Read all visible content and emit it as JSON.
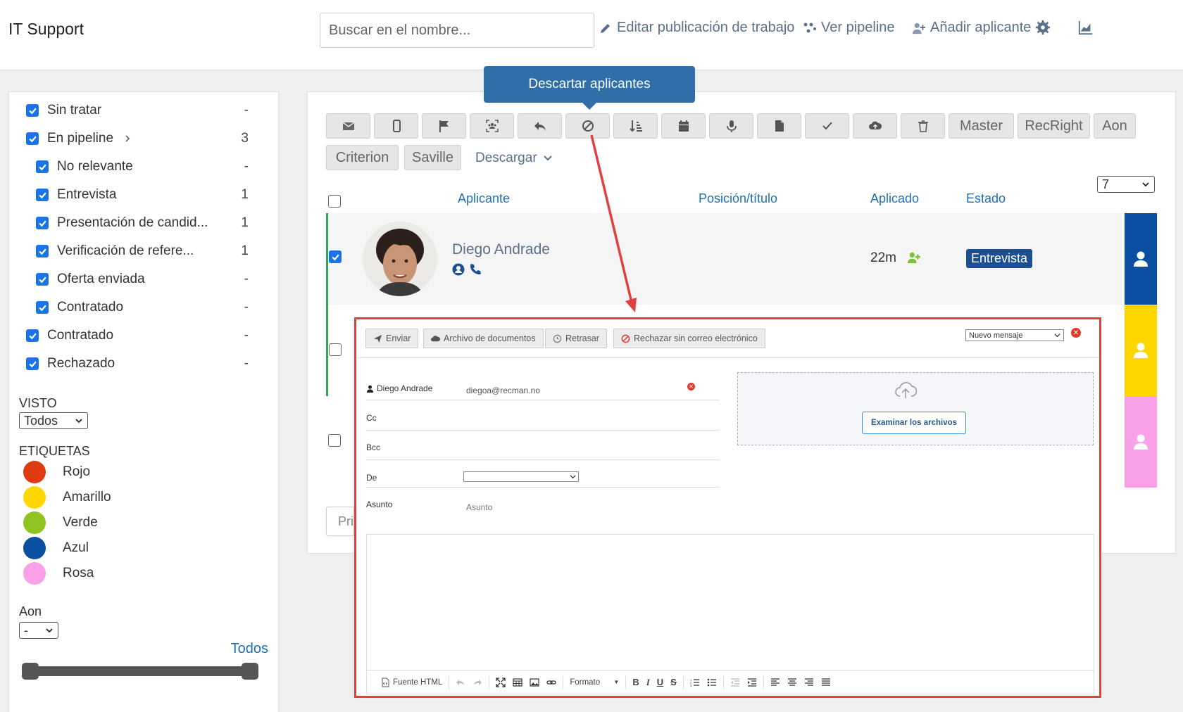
{
  "header": {
    "title": "IT Support",
    "search_placeholder": "Buscar en el nombre...",
    "edit_job": "Editar publicación de trabajo",
    "pipeline": "Ver pipeline",
    "add_applicant": "Añadir aplicante"
  },
  "filters": {
    "items": [
      {
        "label": "Sin tratar",
        "count": "-"
      },
      {
        "label": "En pipeline",
        "count": "3"
      },
      {
        "label": "No relevante",
        "count": "-"
      },
      {
        "label": "Entrevista",
        "count": "1"
      },
      {
        "label": "Presentación de candid...",
        "count": "1"
      },
      {
        "label": "Verificación de refere...",
        "count": "1"
      },
      {
        "label": "Oferta enviada",
        "count": "-"
      },
      {
        "label": "Contratado",
        "count": "-"
      },
      {
        "label": "Contratado",
        "count": "-"
      },
      {
        "label": "Rechazado",
        "count": "-"
      }
    ],
    "seen_label": "VISTO",
    "seen_value": "Todos",
    "tags_label": "ETIQUETAS",
    "tags": [
      {
        "label": "Rojo",
        "color": "#e03a12"
      },
      {
        "label": "Amarillo",
        "color": "#ffd600"
      },
      {
        "label": "Verde",
        "color": "#8fc31f"
      },
      {
        "label": "Azul",
        "color": "#0b4fa3"
      },
      {
        "label": "Rosa",
        "color": "#f9a0e8"
      }
    ],
    "aon_label": "Aon",
    "aon_value": "-",
    "all_link": "Todos"
  },
  "toolbar": {
    "master": "Master",
    "recright": "RecRight",
    "aon": "Aon",
    "criterion": "Criterion",
    "saville": "Saville",
    "download": "Descargar",
    "tooltip": "Descartar aplicantes"
  },
  "table": {
    "col_applicant": "Aplicante",
    "col_position": "Posición/título",
    "col_applied": "Aplicado",
    "col_status": "Estado",
    "rows_per_page": "7",
    "row1": {
      "name": "Diego Andrade",
      "applied": "22m",
      "status": "Entrevista"
    },
    "prev_label": "Pri"
  },
  "colors": {
    "strip1": "#0b4fa3",
    "strip2": "#ffd600",
    "strip3": "#f9a0e8"
  },
  "dialog": {
    "send": "Enviar",
    "docs": "Archivo de documentos",
    "delay": "Retrasar",
    "reject": "Rechazar sin correo electrónico",
    "template": "Nuevo mensaje",
    "to_name": "Diego Andrade",
    "to_email": "diegoa@recman.no",
    "cc": "Cc",
    "bcc": "Bcc",
    "from": "De",
    "subject_label": "Asunto",
    "subject_placeholder": "Asunto",
    "browse": "Examinar los archivos",
    "html_source": "Fuente HTML",
    "format": "Formato"
  }
}
